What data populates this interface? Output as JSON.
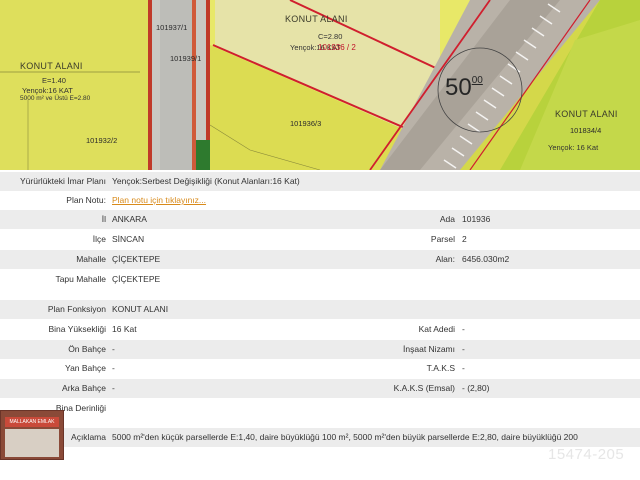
{
  "map": {
    "road_width_main": "50",
    "road_width_sup": "00",
    "labels": {
      "left_zone_title": "KONUT ALANI",
      "left_zone_emsal": "E=1.40",
      "left_zone_kat": "Yençok:16 KAT",
      "left_zone_note": "5000 m² ve Üstü E=2.80",
      "left_parcel": "101932/2",
      "top_parcel_a": "101937/1",
      "top_parcel_b": "101939/1",
      "center_zone_title": "KONUT ALANI",
      "center_zone_emsal": "C=2.80",
      "center_zone_kat": "Yençok:16 KAT",
      "active_parcel": "101936 / 2",
      "center_parcel": "101936/3",
      "right_zone_title": "KONUT ALANI",
      "right_parcel": "101834/4",
      "right_zone_kat": "Yençok: 16 Kat"
    }
  },
  "plan": {
    "yururlukteki_label": "Yürürlükteki İmar Planı",
    "yururlukteki_value": "Yençok:Serbest Değişikliği (Konut Alanları:16 Kat)",
    "plan_notu_label": "Plan Notu:",
    "plan_notu_link": "Plan notu için tıklayınız..."
  },
  "location": {
    "il_label": "İl",
    "il_value": "ANKARA",
    "ilce_label": "İlçe",
    "ilce_value": "SİNCAN",
    "mahalle_label": "Mahalle",
    "mahalle_value": "ÇİÇEKTEPE",
    "tapu_label": "Tapu Mahalle",
    "tapu_value": "ÇİÇEKTEPE",
    "ada_label": "Ada",
    "ada_value": "101936",
    "parsel_label": "Parsel",
    "parsel_value": "2",
    "alan_label": "Alan:",
    "alan_value": "6456.030m2"
  },
  "details": {
    "fonksiyon_label": "Plan Fonksiyon",
    "fonksiyon_value": "KONUT ALANI",
    "yukseklik_label": "Bina Yüksekliği",
    "yukseklik_value": "16 Kat",
    "on_bahce_label": "Ön Bahçe",
    "on_bahce_value": "-",
    "yan_bahce_label": "Yan Bahçe",
    "yan_bahce_value": "-",
    "arka_bahce_label": "Arka Bahçe",
    "arka_bahce_value": "-",
    "derinlik_label": "Bina Derinliği",
    "derinlik_value": "",
    "kat_adedi_label": "Kat Adedi",
    "kat_adedi_value": "-",
    "insaat_label": "İnşaat Nizamı",
    "insaat_value": "-",
    "taks_label": "T.A.K.S",
    "taks_value": "-",
    "kaks_label": "K.A.K.S (Emsal)",
    "kaks_value": "- (2,80)",
    "aciklama_label": "Açıklama",
    "aciklama_value": "5000 m²'den küçük parsellerde E:1,40, daire büyüklüğü 100 m², 5000 m²'den büyük parsellerde E:2,80, daire büyüklüğü 200"
  },
  "overlay": {
    "thumbnail_sign": "MALLAKAN EMLAK",
    "watermark": "15474-205"
  },
  "colors": {
    "zone_yellow": "#d4d84a",
    "parcel_border": "#d01f2e",
    "row_shade": "#ececec",
    "link": "#d88a1a"
  }
}
